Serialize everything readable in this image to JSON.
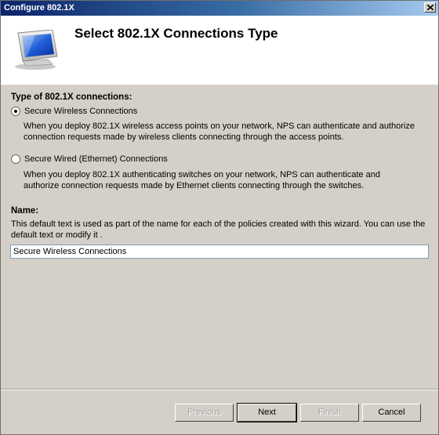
{
  "window": {
    "title": "Configure 802.1X"
  },
  "header": {
    "title": "Select 802.1X Connections Type",
    "icon": "monitor-icon"
  },
  "connection_type": {
    "label": "Type of 802.1X connections:",
    "options": [
      {
        "label": "Secure Wireless Connections",
        "description": "When you deploy 802.1X wireless access points on your network, NPS can authenticate and authorize connection requests made by wireless clients connecting through the access points.",
        "selected": true
      },
      {
        "label": "Secure Wired (Ethernet) Connections",
        "description": "When you deploy 802.1X authenticating switches on your network, NPS can authenticate and authorize connection requests made by Ethernet clients connecting through the switches.",
        "selected": false
      }
    ]
  },
  "name": {
    "label": "Name:",
    "description": "This default text is used as part of the name for each of the policies created with this wizard. You can use the default text or modify it .",
    "value": "Secure Wireless Connections"
  },
  "buttons": {
    "previous": "Previous",
    "next": "Next",
    "finish": "Finish",
    "cancel": "Cancel"
  },
  "colors": {
    "titlebar_start": "#0a246a",
    "titlebar_end": "#a6caf0",
    "dialog_bg": "#d4d0c8"
  }
}
